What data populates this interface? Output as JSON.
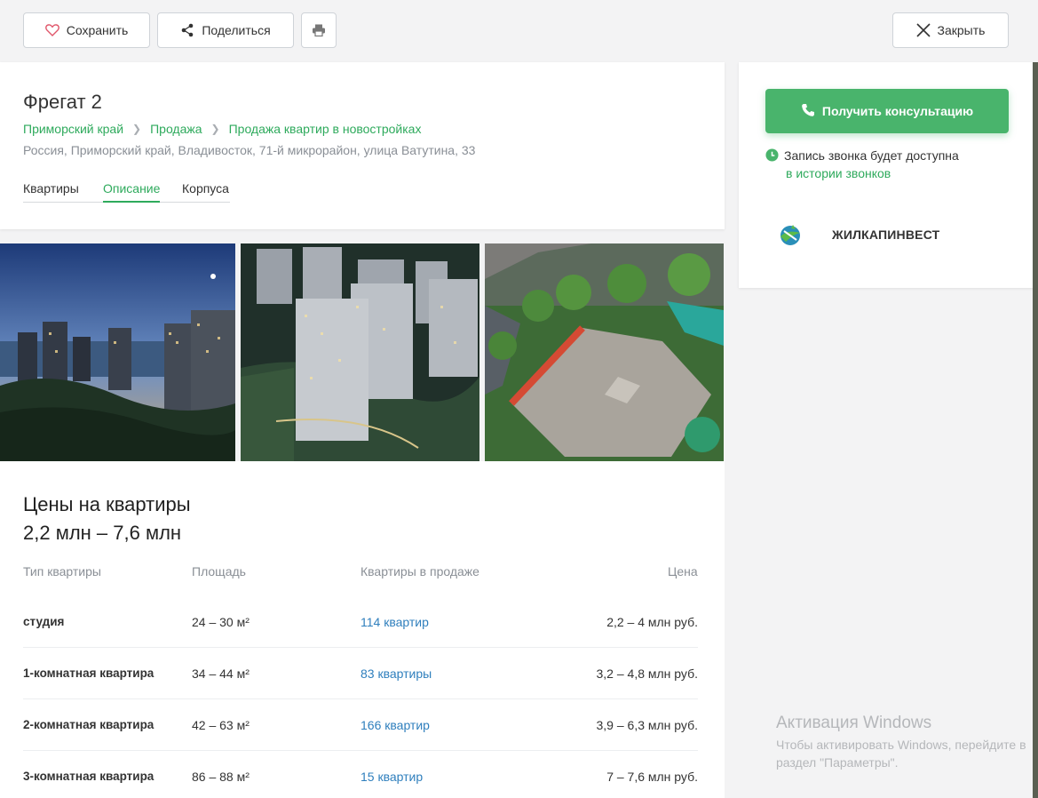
{
  "toolbar": {
    "save_label": "Сохранить",
    "share_label": "Поделиться",
    "close_label": "Закрыть"
  },
  "listing": {
    "title": "Фрегат 2",
    "breadcrumbs": [
      "Приморский край",
      "Продажа",
      "Продажа квартир в новостройках"
    ],
    "address": "Россия, Приморский край, Владивосток, 71-й микрорайон, улица Ватутина, 33",
    "tabs": [
      "Квартиры",
      "Описание",
      "Корпуса"
    ],
    "active_tab": "Описание"
  },
  "prices": {
    "heading": "Цены на квартиры",
    "range": "2,2 млн – 7,6 млн",
    "columns": [
      "Тип квартиры",
      "Площадь",
      "Квартиры в продаже",
      "Цена"
    ],
    "rows": [
      {
        "type": "студия",
        "area": "24 – 30 м²",
        "count": "114 квартир",
        "price": "2,2 – 4 млн руб."
      },
      {
        "type": "1-комнатная квартира",
        "area": "34 – 44 м²",
        "count": "83 квартиры",
        "price": "3,2 – 4,8 млн руб."
      },
      {
        "type": "2-комнатная квартира",
        "area": "42 – 63 м²",
        "count": "166 квартир",
        "price": "3,9 – 6,3 млн руб."
      },
      {
        "type": "3-комнатная квартира",
        "area": "86 – 88 м²",
        "count": "15 квартир",
        "price": "7 – 7,6 млн руб."
      }
    ]
  },
  "sidebar": {
    "consult_label": "Получить консультацию",
    "record_note": "Запись звонка будет доступна",
    "record_link": "в истории звонков",
    "developer": "ЖИЛКАПИНВЕСТ"
  },
  "watermark": {
    "title": "Активация Windows",
    "text": "Чтобы активировать Windows, перейдите в раздел \"Параметры\"."
  },
  "colors": {
    "accent_green": "#2eaa5c",
    "button_green": "#49b46c",
    "link_blue": "#2f7fbd"
  }
}
